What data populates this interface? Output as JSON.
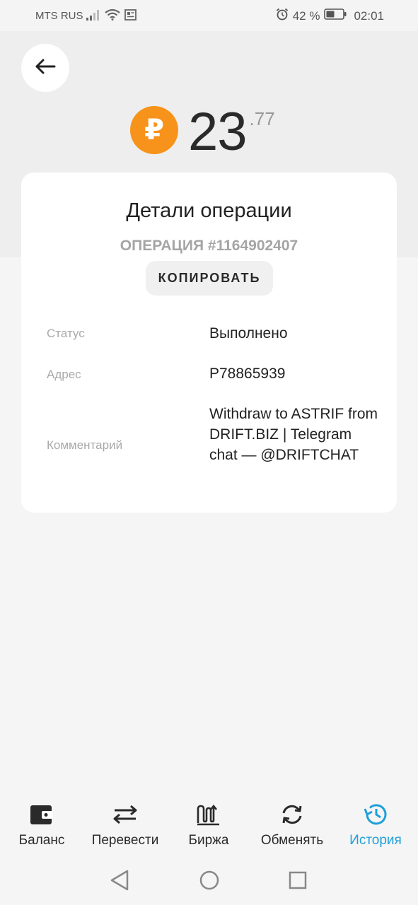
{
  "status_bar": {
    "carrier": "MTS RUS",
    "battery": "42 %",
    "time": "02:01",
    "icons": [
      "signal-icon",
      "wifi-icon",
      "news-icon",
      "alarm-icon",
      "battery-icon"
    ]
  },
  "header": {
    "back_icon": "arrow-left-icon",
    "currency_icon": "ruble-icon",
    "currency_symbol": "₽",
    "amount_integer": "23",
    "amount_fraction": ".77",
    "coin_color": "#f7931a"
  },
  "details": {
    "title": "Детали операции",
    "operation_number": "ОПЕРАЦИЯ #1164902407",
    "copy_label": "КОПИРОВАТЬ",
    "status_label": "Статус",
    "status_value": "Выполнено",
    "address_label": "Адрес",
    "address_value": "P78865939",
    "comment_label": "Комментарий",
    "comment_value": "Withdraw to ASTRIF from DRIFT.BIZ | Telegram chat — @DRIFTCHAT"
  },
  "tabs": [
    {
      "label": "Баланс",
      "icon": "wallet-icon",
      "active": false
    },
    {
      "label": "Перевести",
      "icon": "transfer-icon",
      "active": false
    },
    {
      "label": "Биржа",
      "icon": "exchange-chart-icon",
      "active": false
    },
    {
      "label": "Обменять",
      "icon": "swap-icon",
      "active": false
    },
    {
      "label": "История",
      "icon": "history-icon",
      "active": true
    }
  ],
  "colors": {
    "accent": "#1fa0d8",
    "coin": "#f7931a"
  },
  "system_nav": [
    "back-triangle-icon",
    "home-circle-icon",
    "recents-square-icon"
  ]
}
